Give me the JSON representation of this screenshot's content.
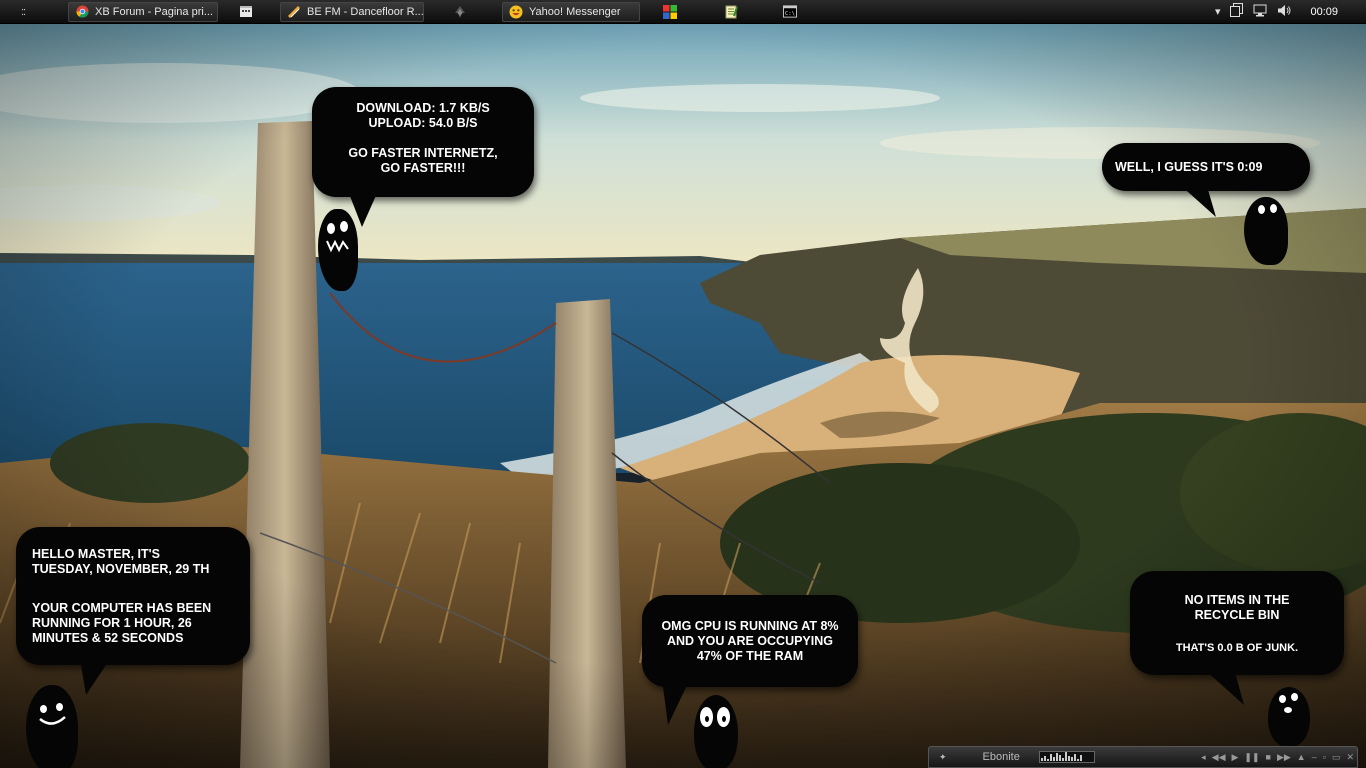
{
  "taskbar": {
    "start_glyph": "::",
    "buttons": [
      {
        "label": "XB Forum - Pagina pri...",
        "icon": "chrome-icon"
      },
      {
        "label": "",
        "icon": "media-icon"
      },
      {
        "label": "BE FM - Dancefloor R...",
        "icon": "radio-icon"
      },
      {
        "label": "",
        "icon": "winamp-icon"
      },
      {
        "label": "Yahoo! Messenger",
        "icon": "yahoo-messenger-icon"
      },
      {
        "label": "",
        "icon": "windows-logo-icon"
      },
      {
        "label": "",
        "icon": "notepad-icon"
      },
      {
        "label": "",
        "icon": "command-prompt-icon"
      }
    ],
    "tray": {
      "chevron": "▾",
      "icons": [
        "copy-icon",
        "network-icon",
        "volume-icon"
      ],
      "clock": "00:09"
    }
  },
  "widgets": {
    "network": {
      "line1": "DOWNLOAD: 1.7 KB/S",
      "line2": "UPLOAD: 54.0 B/S",
      "line3": "GO FASTER INTERNETZ,",
      "line4": "GO FASTER!!!"
    },
    "time": {
      "text": "WELL, I GUESS IT'S 0:09"
    },
    "uptime": {
      "line1": "HELLO MASTER, IT'S",
      "line2": "TUESDAY, NOVEMBER, 29 TH",
      "line3": "YOUR COMPUTER HAS BEEN",
      "line4": "RUNNING FOR  1 HOUR, 26",
      "line5": "MINUTES & 52 SECONDS"
    },
    "cpu": {
      "line1": "OMG CPU IS RUNNING AT 8%",
      "line2": "AND YOU ARE OCCUPYING",
      "line3": "47% OF THE RAM"
    },
    "recycle_bin": {
      "line1": "NO ITEMS IN THE",
      "line2": "RECYCLE BIN",
      "line3": "THAT'S 0.0 B OF JUNK."
    }
  },
  "media_player": {
    "skin_name": "Ebonite",
    "controls": [
      "◂",
      "◀◀",
      "▶",
      "❚❚",
      "■",
      "▶▶",
      "▲",
      "–",
      "▫",
      "▭",
      "✕"
    ]
  },
  "colors": {
    "taskbar": "#1a1a1a",
    "bubble": "#050505",
    "sky": "#9ec3cc",
    "sea": "#1f5a86",
    "sand": "#d8b07a",
    "grass": "#8a6a3a"
  }
}
